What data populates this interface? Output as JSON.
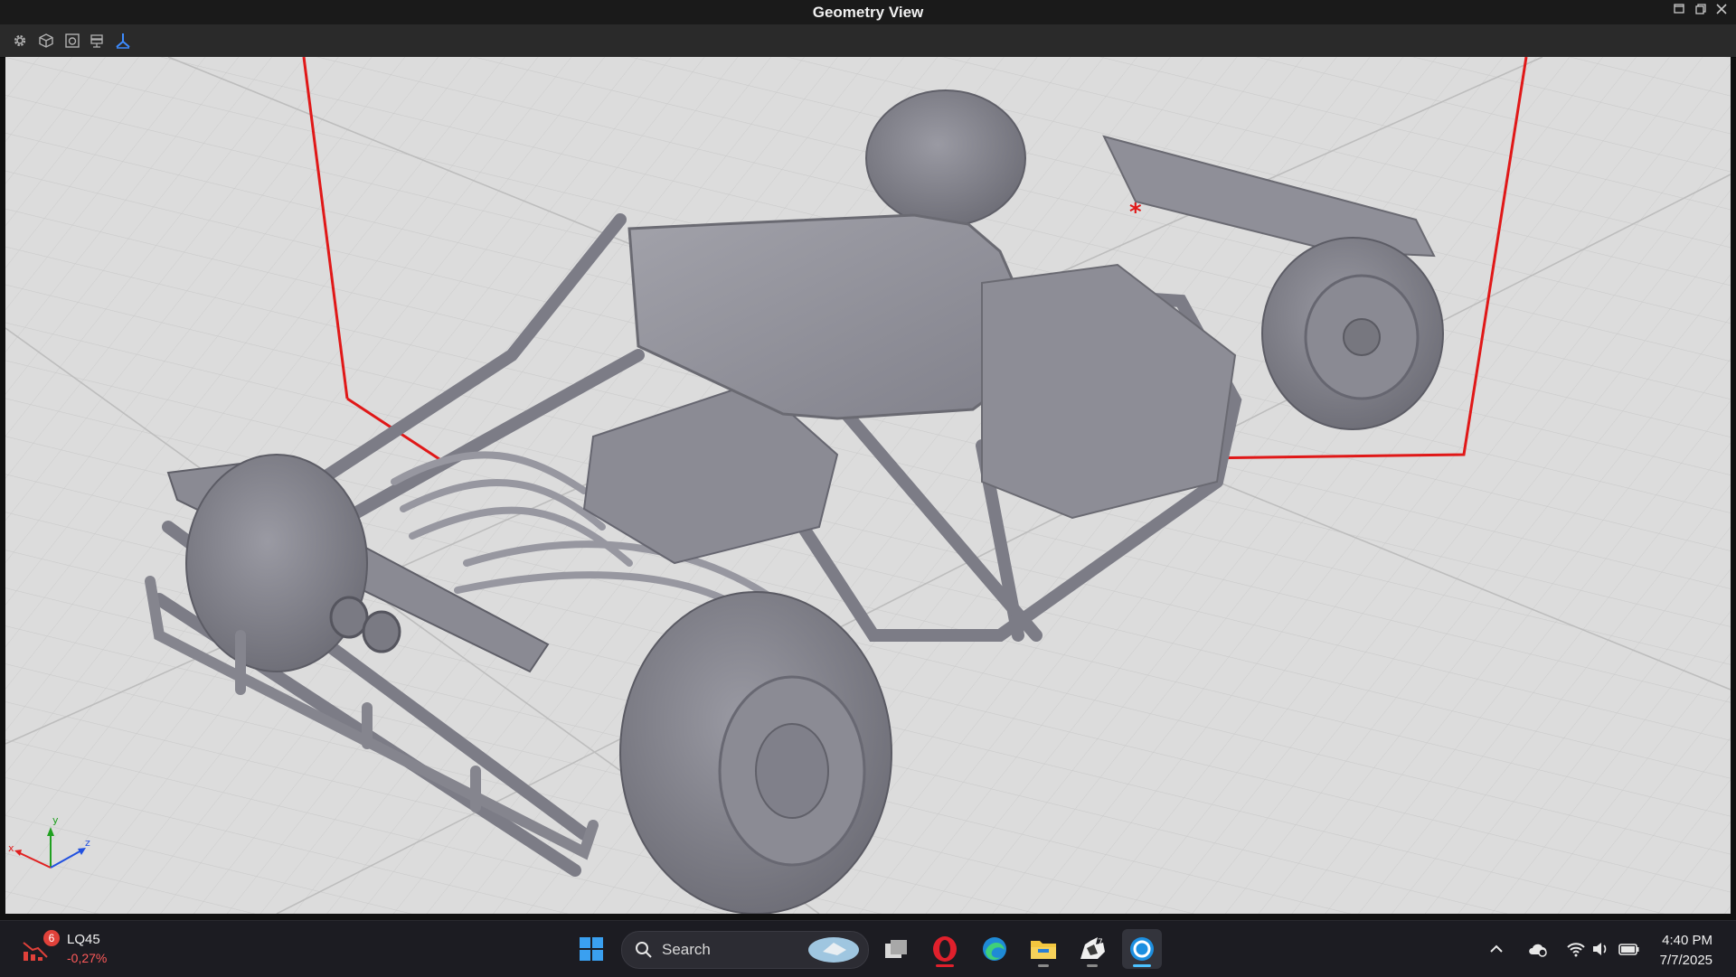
{
  "window": {
    "title": "Geometry View",
    "controls": [
      "minimize-icon",
      "restore-icon",
      "close-icon"
    ]
  },
  "toolbar": {
    "buttons": [
      {
        "name": "settings-icon"
      },
      {
        "name": "cube-view-icon"
      },
      {
        "name": "screenshot-icon"
      },
      {
        "name": "layers-icon"
      },
      {
        "name": "axes-toggle-icon",
        "active": true
      }
    ]
  },
  "viewport": {
    "axis_labels": {
      "x": "x",
      "y": "y",
      "z": "z"
    },
    "colors": {
      "background": "#dcdcdc",
      "bounding_box": "#e01818",
      "model": "#8c8c96",
      "axis_x": "#e02020",
      "axis_y": "#20a020",
      "axis_z": "#2050e0"
    }
  },
  "taskbar": {
    "widget": {
      "ticker": "LQ45",
      "change": "-0,27%",
      "notification_count": "6"
    },
    "search": {
      "placeholder": "Search"
    },
    "apps": [
      "windows-start-icon",
      "task-view-icon",
      "opera-browser-icon",
      "edge-browser-icon",
      "file-explorer-icon",
      "rhino-icon",
      "app-icon-active"
    ],
    "tray": {
      "icons": [
        "chevron-up-icon",
        "cloud-sync-icon",
        "wifi-icon",
        "volume-icon",
        "battery-icon"
      ]
    },
    "clock": {
      "time": "4:40 PM",
      "date": "7/7/2025"
    }
  }
}
